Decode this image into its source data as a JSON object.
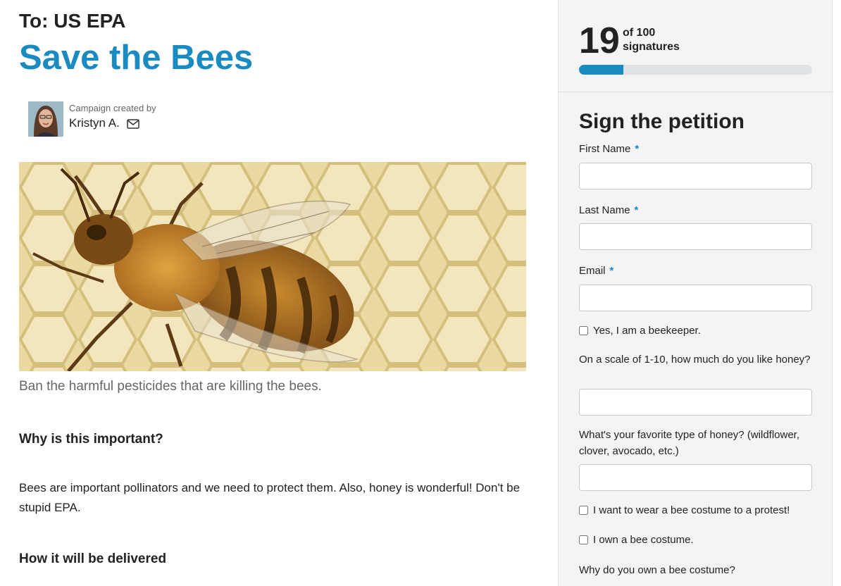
{
  "petition": {
    "target": "To: US EPA",
    "title": "Save the Bees",
    "created_by_label": "Campaign created by",
    "creator_name": "Kristyn A.",
    "image_caption": "Ban the harmful pesticides that are killing the bees.",
    "why_heading": "Why is this important?",
    "why_body": "Bees are important pollinators and we need to protect them. Also, honey is wonderful! Don't be stupid EPA.",
    "delivery_heading": "How it will be delivered"
  },
  "signatures": {
    "count": "19",
    "of_label": "of 100",
    "signatures_label": "signatures",
    "progress_fraction": 0.19
  },
  "form": {
    "title": "Sign the petition",
    "required_mark": "*",
    "first_name_label": "First Name",
    "last_name_label": "Last Name",
    "email_label": "Email",
    "beekeeper_label": "Yes, I am a beekeeper.",
    "honey_scale_label": "On a scale of 1-10, how much do you like honey?",
    "honey_type_label": "What's your favorite type of honey? (wildflower, clover, avocado, etc.)",
    "costume_protest_label": "I want to wear a bee costume to a protest!",
    "own_costume_label": "I own a bee costume.",
    "why_costume_label": "Why do you own a bee costume?"
  },
  "icons": {
    "mail": "envelope-icon"
  },
  "colors": {
    "accent": "#1a8bc0",
    "sidebar_bg": "#f4f4f4"
  }
}
